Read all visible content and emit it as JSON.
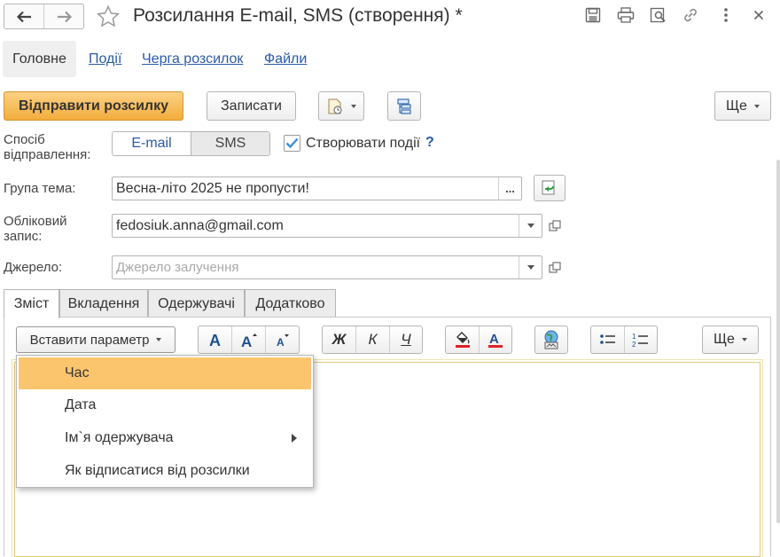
{
  "window": {
    "title": "Розсилання E-mail, SMS (створення) *"
  },
  "section_tabs": [
    {
      "label": "Головне"
    },
    {
      "label": "Події"
    },
    {
      "label": "Черга розсилок"
    },
    {
      "label": "Файли"
    }
  ],
  "toolbar": {
    "send_label": "Відправити розсилку",
    "save_label": "Записати",
    "more_label": "Ще"
  },
  "form": {
    "method_label": "Спосіб відправлення:",
    "method_options": [
      "E-mail",
      "SMS"
    ],
    "method_selected": "E-mail",
    "create_events_label": "Створювати події",
    "create_events_checked": true,
    "help_label": "?",
    "subject_label": "Група тема:",
    "subject_value": "Весна-літо 2025 не пропусти!",
    "subject_select_label": "...",
    "account_label": "Обліковий запис:",
    "account_value": "fedosiuk.anna@gmail.com",
    "source_label": "Джерело:",
    "source_placeholder": "Джерело залучення"
  },
  "content_tabs": [
    {
      "label": "Зміст",
      "active": true
    },
    {
      "label": "Вкладення",
      "active": false
    },
    {
      "label": "Одержувачі",
      "active": false
    },
    {
      "label": "Додатково",
      "active": false
    }
  ],
  "editor_toolbar": {
    "insert_param_label": "Вставити параметр",
    "bold_label": "Ж",
    "italic_label": "К",
    "underline_label": "Ч",
    "more_label": "Ще"
  },
  "insert_menu": {
    "items": [
      {
        "label": "Час",
        "highlighted": true,
        "submenu": false
      },
      {
        "label": "Дата",
        "highlighted": false,
        "submenu": false
      },
      {
        "label": "Ім`я одержувача",
        "highlighted": false,
        "submenu": true
      },
      {
        "label": "Як відписатися від розсилки",
        "highlighted": false,
        "submenu": false
      }
    ]
  },
  "colors": {
    "accent_orange": "#f2ad3c",
    "menu_highlight": "#fbc56e",
    "link_blue": "#2a5aa8",
    "check_blue": "#3b8fd8",
    "text_color_red": "#d22"
  },
  "icons": [
    "back-arrow-icon",
    "forward-arrow-icon",
    "star-icon",
    "save-icon",
    "print-icon",
    "preview-icon",
    "link-icon",
    "kebab-icon",
    "close-icon",
    "report-icon",
    "structure-icon",
    "refresh-icon",
    "open-form-icon",
    "font-grow-icon",
    "font-shrink-icon",
    "fill-color-icon",
    "text-color-icon",
    "insert-image-icon",
    "bullet-list-icon",
    "numbered-list-icon"
  ]
}
